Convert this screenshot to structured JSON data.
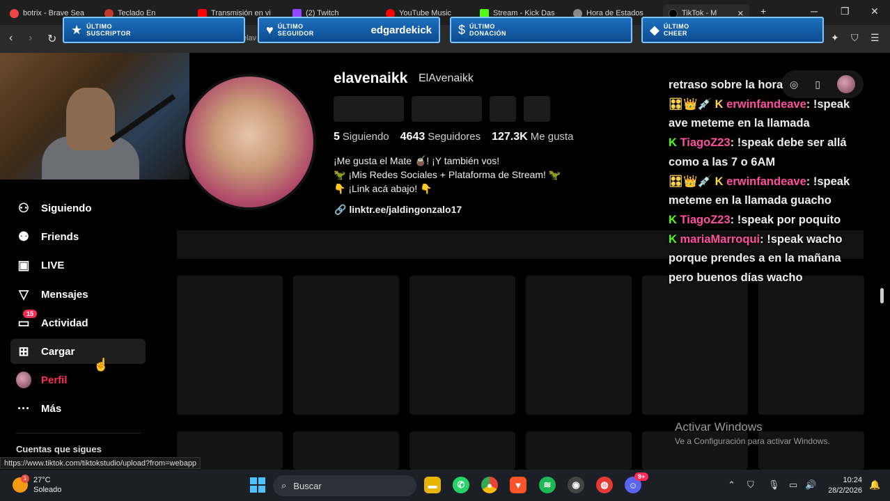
{
  "browser": {
    "tabs": [
      {
        "label": "botrix - Brave Sea",
        "color": "#e44"
      },
      {
        "label": "Teclado En",
        "color": "#c0392b"
      },
      {
        "label": "Transmisión en vi",
        "color": "#ff0000"
      },
      {
        "label": "(2) Twitch",
        "color": "#9146ff"
      },
      {
        "label": "YouTube Music",
        "color": "#ff0000"
      },
      {
        "label": "Stream - Kick Das",
        "color": "#53fc18"
      },
      {
        "label": "Hora de Estados",
        "color": "#888"
      },
      {
        "label": "TikTok - M",
        "color": "#000"
      }
    ],
    "url_fragment": "elav",
    "status_url": "https://www.tiktok.com/tiktokstudio/upload?from=webapp"
  },
  "alerts": [
    {
      "label_top": "ÚLTIMO",
      "label_bottom": "SUSCRIPTOR",
      "value": "",
      "icon": "star-icon"
    },
    {
      "label_top": "ÚLTIMO",
      "label_bottom": "SEGUIDOR",
      "value": "edgardekick",
      "icon": "heart-icon"
    },
    {
      "label_top": "ÚLTIMO",
      "label_bottom": "DONACIÓN",
      "value": "",
      "icon": "dollar-icon"
    },
    {
      "label_top": "ÚLTIMO",
      "label_bottom": "CHEER",
      "value": "",
      "icon": "diamond-icon"
    }
  ],
  "sidebar": {
    "items": [
      {
        "label": "Siguiendo",
        "icon": "person-plus-icon"
      },
      {
        "label": "Friends",
        "icon": "friends-icon"
      },
      {
        "label": "LIVE",
        "icon": "live-tv-icon"
      },
      {
        "label": "Mensajes",
        "icon": "send-icon"
      },
      {
        "label": "Actividad",
        "icon": "inbox-icon",
        "badge": "15"
      },
      {
        "label": "Cargar",
        "icon": "plus-square-icon"
      },
      {
        "label": "Perfil",
        "icon": "avatar-icon"
      },
      {
        "label": "Más",
        "icon": "more-icon"
      }
    ],
    "footer": "Cuentas que sigues"
  },
  "profile": {
    "username": "elavenaikk",
    "nickname": "ElAvenaikk",
    "following_count": "5",
    "following_label": "Siguiendo",
    "followers_count": "4643",
    "followers_label": "Seguidores",
    "likes_count": "127.3K",
    "likes_label": "Me gusta",
    "bio_line1": "¡Me gusta el Mate 🧉! ¡Y también vos!",
    "bio_line2": "🦖 ¡Mis Redes Sociales + Plataforma de Stream! 🦖",
    "bio_line3": "👇 ¡Link acá abajo! 👇",
    "link": "linktr.ee/jaldingonzalo17"
  },
  "chat": {
    "first_line": "retraso sobre la hora",
    "messages": [
      {
        "badges": "🎛👑💉 K",
        "user": "erwinfandeave",
        "text": "!speak ave meteme en la llamada"
      },
      {
        "badges": "K",
        "user": "TiagoZ23",
        "text": "!speak debe ser allá como a las 7 o 6AM"
      },
      {
        "badges": "🎛👑💉 K",
        "user": "erwinfandeave",
        "text": "!speak meteme en la llamada guacho"
      },
      {
        "badges": "K",
        "user": "TiagoZ23",
        "text": "!speak por poquito"
      },
      {
        "badges": "K",
        "user": "mariaMarroqui",
        "text": "!speak wacho porque prendes a en la mañana pero buenos días wacho"
      }
    ]
  },
  "windows_notice": {
    "title": "Activar Windows",
    "subtitle": "Ve a Configuración para activar Windows."
  },
  "taskbar": {
    "temperature": "27°C",
    "weather": "Soleado",
    "weather_badge": "1",
    "search_placeholder": "Buscar",
    "time": "10:24",
    "date": "28/2/2026",
    "discord_badge": "9+"
  }
}
